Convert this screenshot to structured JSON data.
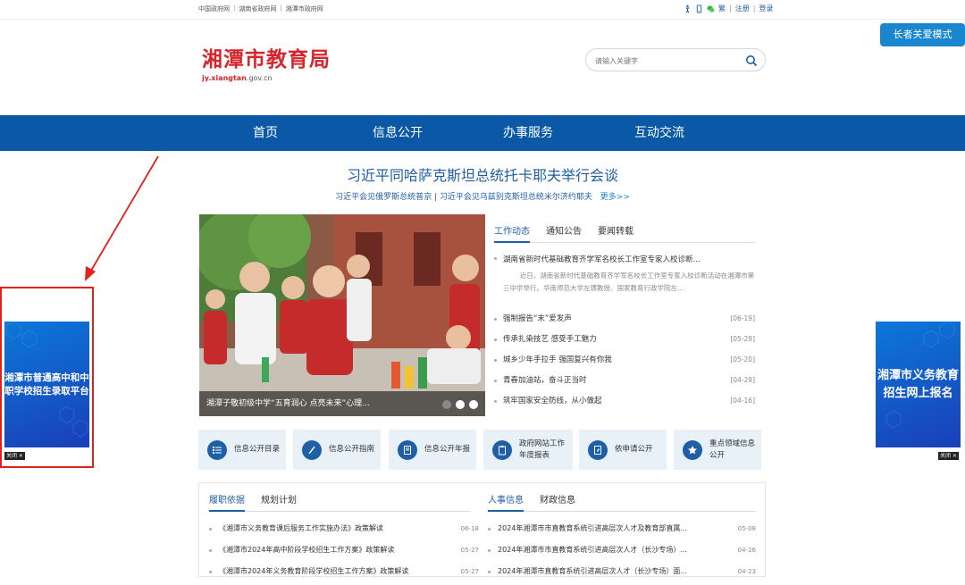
{
  "topbar": {
    "links": [
      "中国政府网",
      "湖南省政府网",
      "湘潭市政府网"
    ],
    "separator": "|",
    "tools": [
      "繁",
      "注册",
      "登录"
    ]
  },
  "elder_mode": "长者关爱模式",
  "header": {
    "site_name": "湘潭市教育局",
    "domain_bold": "jy.xiangtan",
    "domain_rest": ".gov.cn",
    "search_placeholder": "请输入关键字"
  },
  "nav": [
    "首页",
    "信息公开",
    "办事服务",
    "互动交流"
  ],
  "headline": {
    "title": "习近平同哈萨克斯坦总统托卡耶夫举行会谈",
    "sub1": "习近平会见俄罗斯总统普京",
    "sub_sep": "|",
    "sub2": "习近平会见乌兹别克斯坦总统米尔济约耶夫",
    "more": "更多>>"
  },
  "photo": {
    "caption": "湘潭子敬初级中学“五育润心 点亮未来”心理..."
  },
  "news": {
    "tabs": [
      "工作动态",
      "通知公告",
      "要闻转载"
    ],
    "featured_title": "湖南省新时代基础教育齐学军名校长工作室专家入校诊断...",
    "featured_desc": "近日，湖南省新时代基础教育齐学军名校长工作室专家入校诊断活动在湘潭市第三中学举行。华南师范大学左璜教授、国家教育行政学院左...",
    "items": [
      {
        "title": "强制报告“末”爱发声",
        "date": "[06-19]"
      },
      {
        "title": "传承扎染技艺 感受手工魅力",
        "date": "[05-29]"
      },
      {
        "title": "城乡少年手拉手 强国复兴有你我",
        "date": "[05-20]"
      },
      {
        "title": "青春加油站，奋斗正当时",
        "date": "[04-29]"
      },
      {
        "title": "筑牢国家安全防线，从小做起",
        "date": "[04-16]"
      }
    ]
  },
  "services": [
    {
      "label": "信息公开目录",
      "icon": "list-icon"
    },
    {
      "label": "信息公开指南",
      "icon": "compass-icon"
    },
    {
      "label": "信息公开年报",
      "icon": "report-icon"
    },
    {
      "label": "政府网站工作年度报表",
      "icon": "clipboard-icon"
    },
    {
      "label": "依申请公开",
      "icon": "apply-icon"
    },
    {
      "label": "重点领域信息公开",
      "icon": "star-icon"
    }
  ],
  "panel_left": {
    "tabs": [
      "履职依据",
      "规划计划"
    ],
    "items": [
      {
        "title": "《湘潭市义务教育课后服务工作实施办法》政策解读",
        "date": "06-18"
      },
      {
        "title": "《湘潭市2024年高中阶段学校招生工作方案》政策解读",
        "date": "05-27"
      },
      {
        "title": "《湘潭市2024年义务教育阶段学校招生工作方案》政策解读",
        "date": "05-27"
      }
    ]
  },
  "panel_right": {
    "tabs": [
      "人事信息",
      "财政信息"
    ],
    "items": [
      {
        "title": "2024年湘潭市市直教育系统引进高层次人才及教育部直属...",
        "date": "05-08"
      },
      {
        "title": "2024年湘潭市市直教育系统引进高层次人才（长沙专场）...",
        "date": "04-26"
      },
      {
        "title": "2024年湘潭市直教育系统引进高层次人才（长沙专场）面...",
        "date": "04-23"
      }
    ]
  },
  "ads": {
    "left": "湘潭市普通高中和中职学校招生录取平台",
    "right": "湘潭市义务教育招生网上报名",
    "close": "关闭"
  },
  "colors": {
    "nav_bg": "#0a58a6",
    "brand_red": "#d8242b",
    "link_blue": "#1f5fa8",
    "annotation_red": "#e1221b"
  }
}
